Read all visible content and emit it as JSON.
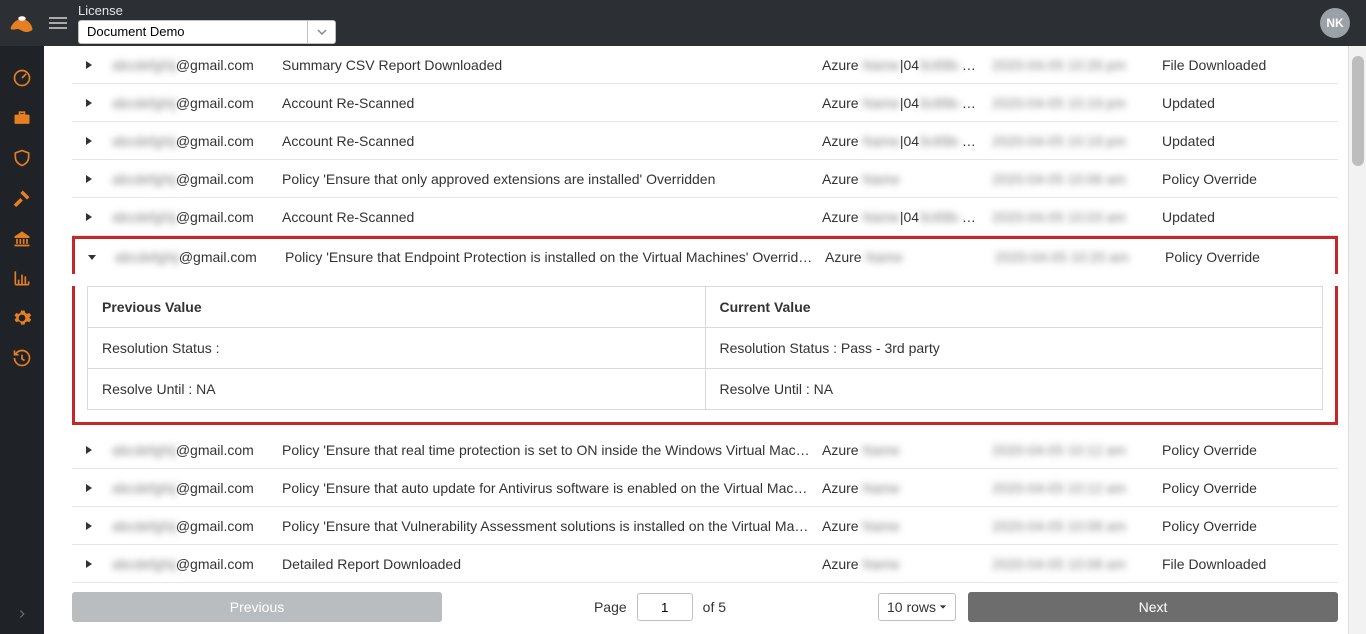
{
  "header": {
    "license_label": "License",
    "license_value": "Document Demo",
    "avatar_initials": "NK"
  },
  "rows": [
    {
      "expanded": false,
      "user_suffix": "@gmail.com",
      "event": "Summary CSV Report Downloaded",
      "account_prefix": "Azure ",
      "account_suffix": "|04",
      "date_blur": "2020-04-05 10:26 pm",
      "tag": "File Downloaded"
    },
    {
      "expanded": false,
      "user_suffix": "@gmail.com",
      "event": "Account Re-Scanned",
      "account_prefix": "Azure ",
      "account_suffix": "|04",
      "date_blur": "2020-04-05 10:19 pm",
      "tag": "Updated"
    },
    {
      "expanded": false,
      "user_suffix": "@gmail.com",
      "event": "Account Re-Scanned",
      "account_prefix": "Azure ",
      "account_suffix": "|04",
      "date_blur": "2020-04-05 10:19 pm",
      "tag": "Updated"
    },
    {
      "expanded": false,
      "user_suffix": "@gmail.com",
      "event": "Policy 'Ensure that only approved extensions are installed' Overridden",
      "account_prefix": "Azure ",
      "account_suffix": "",
      "date_blur": "2020-04-05 10:06 am",
      "tag": "Policy Override"
    },
    {
      "expanded": false,
      "user_suffix": "@gmail.com",
      "event": "Account Re-Scanned",
      "account_prefix": "Azure ",
      "account_suffix": "|04",
      "date_blur": "2020-04-05 10:03 am",
      "tag": "Updated"
    },
    {
      "expanded": true,
      "user_suffix": "@gmail.com",
      "event": "Policy 'Ensure that Endpoint Protection is installed on the Virtual Machines' Overridden",
      "account_prefix": "Azure ",
      "account_suffix": "",
      "date_blur": "2020-04-05 10:20 am",
      "tag": "Policy Override"
    },
    {
      "expanded": false,
      "user_suffix": "@gmail.com",
      "event": "Policy 'Ensure that real time protection is set to ON inside the Windows Virtual Machine' Over…",
      "account_prefix": "Azure ",
      "account_suffix": "",
      "date_blur": "2020-04-05 10:12 am",
      "tag": "Policy Override"
    },
    {
      "expanded": false,
      "user_suffix": "@gmail.com",
      "event": "Policy 'Ensure that auto update for Antivirus software is enabled on the Virtual Machines' Ove…",
      "account_prefix": "Azure ",
      "account_suffix": "",
      "date_blur": "2020-04-05 10:12 am",
      "tag": "Policy Override"
    },
    {
      "expanded": false,
      "user_suffix": "@gmail.com",
      "event": "Policy 'Ensure that Vulnerability Assessment solutions is installed on the Virtual Machines' Ove…",
      "account_prefix": "Azure ",
      "account_suffix": "",
      "date_blur": "2020-04-05 10:08 am",
      "tag": "Policy Override"
    },
    {
      "expanded": false,
      "user_suffix": "@gmail.com",
      "event": "Detailed Report Downloaded",
      "account_prefix": "Azure ",
      "account_suffix": "",
      "date_blur": "2020-04-05 10:08 am",
      "tag": "File Downloaded"
    }
  ],
  "detail": {
    "th_prev": "Previous Value",
    "th_curr": "Current Value",
    "r1_prev": "Resolution Status :",
    "r1_curr": "Resolution Status : Pass - 3rd party",
    "r2_prev": "Resolve Until : NA",
    "r2_curr": "Resolve Until : NA"
  },
  "footer": {
    "prev": "Previous",
    "page_label": "Page",
    "page_value": "1",
    "of_label": "of 5",
    "rows_label": "10 rows",
    "next": "Next"
  }
}
